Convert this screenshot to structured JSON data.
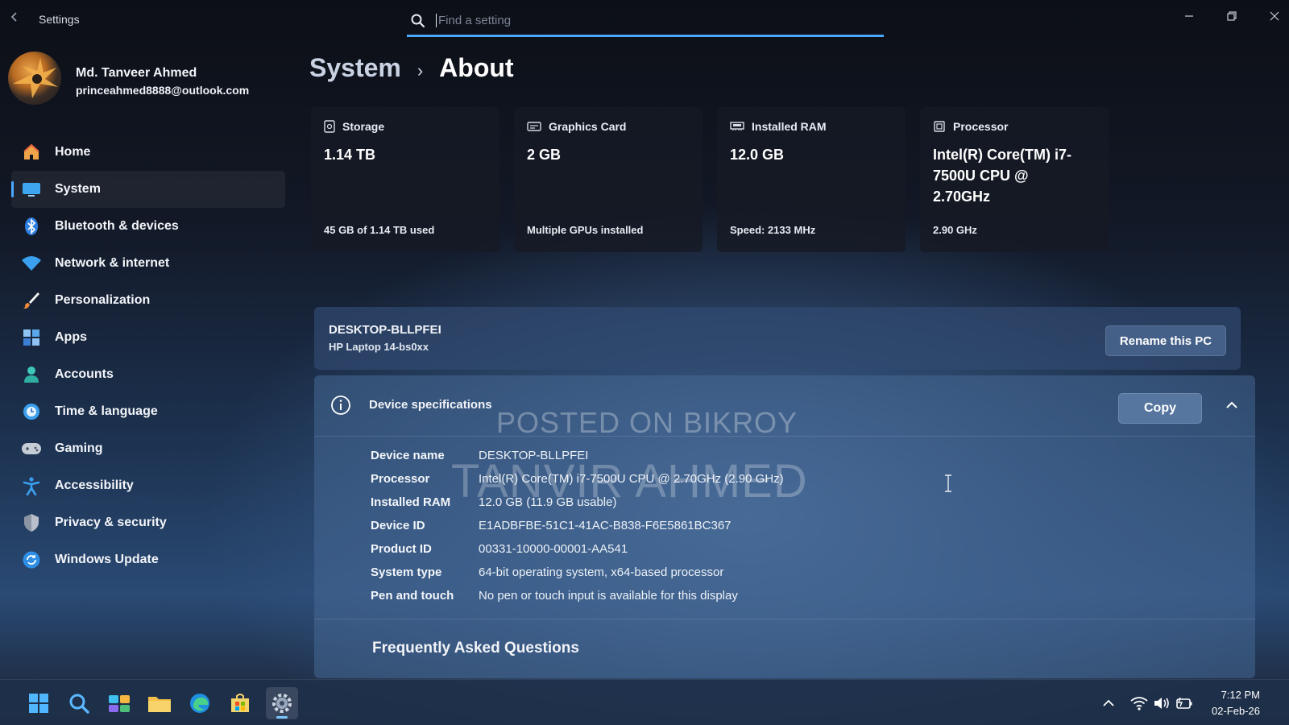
{
  "window": {
    "app_title": "Settings",
    "minimize_icon": "minimize-icon",
    "restore_icon": "restore-icon",
    "close_icon": "close-icon"
  },
  "search": {
    "placeholder": "Find a setting",
    "value": ""
  },
  "profile": {
    "name": "Md. Tanveer Ahmed",
    "email": "princeahmed8888@outlook.com"
  },
  "nav": {
    "items": [
      {
        "label": "Home",
        "icon": "home-icon"
      },
      {
        "label": "System",
        "icon": "system-icon",
        "active": true
      },
      {
        "label": "Bluetooth & devices",
        "icon": "bluetooth-icon"
      },
      {
        "label": "Network & internet",
        "icon": "wifi-icon"
      },
      {
        "label": "Personalization",
        "icon": "brush-icon"
      },
      {
        "label": "Apps",
        "icon": "apps-icon"
      },
      {
        "label": "Accounts",
        "icon": "accounts-icon"
      },
      {
        "label": "Time & language",
        "icon": "clock-globe-icon"
      },
      {
        "label": "Gaming",
        "icon": "gamepad-icon"
      },
      {
        "label": "Accessibility",
        "icon": "accessibility-icon"
      },
      {
        "label": "Privacy & security",
        "icon": "shield-icon"
      },
      {
        "label": "Windows Update",
        "icon": "update-icon"
      }
    ]
  },
  "breadcrumb": {
    "root": "System",
    "separator": "›",
    "current": "About"
  },
  "cards": [
    {
      "title": "Storage",
      "value": "1.14 TB",
      "foot": "45 GB of 1.14 TB used",
      "icon": "storage-icon"
    },
    {
      "title": "Graphics Card",
      "value": "2 GB",
      "foot": "Multiple GPUs installed",
      "icon": "graphics-card-icon"
    },
    {
      "title": "Installed RAM",
      "value": "12.0 GB",
      "foot": "Speed: 2133 MHz",
      "icon": "ram-icon"
    },
    {
      "title": "Processor",
      "value": "Intel(R) Core(TM) i7-7500U CPU @ 2.70GHz",
      "foot": "2.90 GHz",
      "icon": "processor-icon"
    }
  ],
  "pc": {
    "name": "DESKTOP-BLLPFEI",
    "model": "HP Laptop 14-bs0xx",
    "rename_label": "Rename this PC"
  },
  "specs": {
    "title": "Device specifications",
    "copy_label": "Copy",
    "rows": [
      {
        "key": "Device name",
        "value": "DESKTOP-BLLPFEI"
      },
      {
        "key": "Processor",
        "value": "Intel(R) Core(TM) i7-7500U CPU @ 2.70GHz (2.90 GHz)"
      },
      {
        "key": "Installed RAM",
        "value": "12.0 GB (11.9 GB usable)"
      },
      {
        "key": "Device ID",
        "value": "E1ADBFBE-51C1-41AC-B838-F6E5861BC367"
      },
      {
        "key": "Product ID",
        "value": "00331-10000-00001-AA541"
      },
      {
        "key": "System type",
        "value": "64-bit operating system, x64-based processor"
      },
      {
        "key": "Pen and touch",
        "value": "No pen or touch input is available for this display"
      }
    ],
    "faq_label": "Frequently Asked Questions"
  },
  "watermark": {
    "line1": "POSTED ON BIKROY",
    "line2": "TANVIR AHMED"
  },
  "taskbar": {
    "icons": [
      "start-icon",
      "search-icon",
      "widgets-icon",
      "file-explorer-icon",
      "edge-icon",
      "store-icon",
      "settings-icon"
    ],
    "time": "7:12 PM",
    "date": "02-Feb-26"
  },
  "colors": {
    "accent": "#4aa8ff"
  }
}
